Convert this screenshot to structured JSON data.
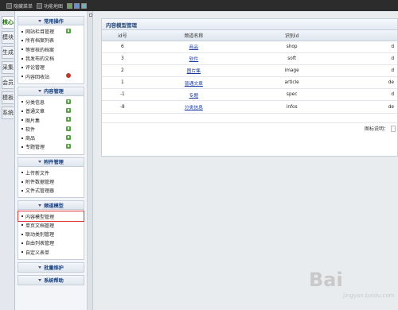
{
  "topbar": {
    "items": [
      {
        "label": "隐藏菜单",
        "icon": "hide-menu-icon"
      },
      {
        "label": "功能地图",
        "icon": "function-map-icon"
      }
    ],
    "theme_icons": [
      "theme-green-icon",
      "theme-blue-icon",
      "theme-teal-icon"
    ]
  },
  "vtabs": [
    {
      "label": "核心",
      "active": true
    },
    {
      "label": "模块"
    },
    {
      "label": "生成"
    },
    {
      "label": "采集"
    },
    {
      "label": "会员"
    },
    {
      "label": "模板"
    },
    {
      "label": "系统"
    }
  ],
  "sidebar": {
    "sections": [
      {
        "title": "常用操作",
        "items": [
          {
            "label": "网站栏目管理",
            "icon": "add"
          },
          {
            "label": "所有档案列表"
          },
          {
            "label": "等审核的档案"
          },
          {
            "label": "我发布的文档"
          },
          {
            "label": "评论管理"
          },
          {
            "label": "内容回收站",
            "icon": "trash"
          }
        ]
      },
      {
        "title": "内容管理",
        "items": [
          {
            "label": "分类信息",
            "icon": "add"
          },
          {
            "label": "普通文章",
            "icon": "add"
          },
          {
            "label": "图片集",
            "icon": "add"
          },
          {
            "label": "软件",
            "icon": "add"
          },
          {
            "label": "商品",
            "icon": "add"
          },
          {
            "label": "专题管理",
            "icon": "add"
          }
        ]
      },
      {
        "title": "附件管理",
        "items": [
          {
            "label": "上传新文件"
          },
          {
            "label": "附件数据管理"
          },
          {
            "label": "文件式管理器"
          }
        ]
      },
      {
        "title": "频道模型",
        "items": [
          {
            "label": "内容模型管理",
            "selected": true
          },
          {
            "label": "单页文档管理"
          },
          {
            "label": "联动类别管理"
          },
          {
            "label": "自由列表管理"
          },
          {
            "label": "自定义表单"
          }
        ]
      },
      {
        "title": "批量维护",
        "items": []
      },
      {
        "title": "系统帮助",
        "items": []
      }
    ]
  },
  "main": {
    "panel_title": "内容模型管理",
    "columns": [
      "id号",
      "频道名称",
      "识别id",
      ""
    ],
    "rows": [
      {
        "id": "6",
        "name": "商品",
        "ident": "shop",
        "extra": "d"
      },
      {
        "id": "3",
        "name": "软件",
        "ident": "soft",
        "extra": "d"
      },
      {
        "id": "2",
        "name": "图片集",
        "ident": "image",
        "extra": "d"
      },
      {
        "id": "1",
        "name": "普通文章",
        "ident": "article",
        "extra": "de"
      },
      {
        "id": "-1",
        "name": "专题",
        "ident": "spec",
        "extra": "d"
      },
      {
        "id": "-8",
        "name": "分类信息",
        "ident": "infos",
        "extra": "de"
      }
    ],
    "legend_label": "图标说明："
  },
  "watermark": {
    "text": "Bai",
    "sub": "jingyan.baidu.com"
  }
}
